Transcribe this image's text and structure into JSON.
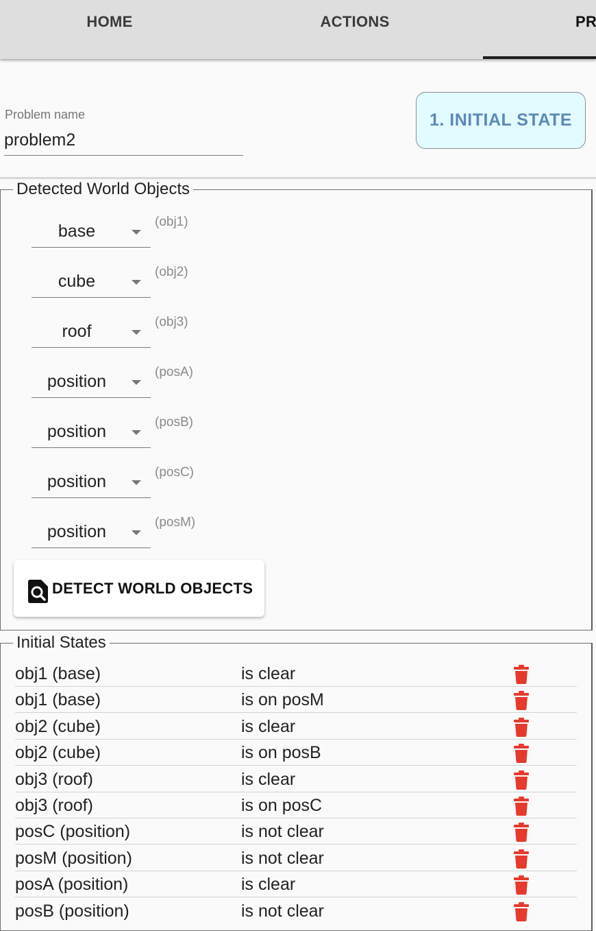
{
  "tabs": {
    "home": "HOME",
    "actions": "ACTIONS",
    "problems": "PROBLEMS",
    "active": "problems"
  },
  "header": {
    "problem_name_label": "Problem name",
    "problem_name_value": "problem2",
    "state_button": "1. INITIAL STATE"
  },
  "world_objects": {
    "legend": "Detected World Objects",
    "items": [
      {
        "type": "base",
        "id": "(obj1)"
      },
      {
        "type": "cube",
        "id": "(obj2)"
      },
      {
        "type": "roof",
        "id": "(obj3)"
      },
      {
        "type": "position",
        "id": "(posA)"
      },
      {
        "type": "position",
        "id": "(posB)"
      },
      {
        "type": "position",
        "id": "(posC)"
      },
      {
        "type": "position",
        "id": "(posM)"
      }
    ],
    "detect_button": "DETECT WORLD OBJECTS",
    "detect_icon": "search-file-icon"
  },
  "initial_states": {
    "legend": "Initial States",
    "rows": [
      {
        "object": "obj1 (base)",
        "predicate": "is clear"
      },
      {
        "object": "obj1 (base)",
        "predicate": "is on posM"
      },
      {
        "object": "obj2 (cube)",
        "predicate": "is clear"
      },
      {
        "object": "obj2 (cube)",
        "predicate": "is on posB"
      },
      {
        "object": "obj3 (roof)",
        "predicate": "is clear"
      },
      {
        "object": "obj3 (roof)",
        "predicate": "is on posC"
      },
      {
        "object": "posC (position)",
        "predicate": "is not clear"
      },
      {
        "object": "posM (position)",
        "predicate": "is not clear"
      },
      {
        "object": "posA (position)",
        "predicate": "is clear"
      },
      {
        "object": "posB (position)",
        "predicate": "is not clear"
      }
    ],
    "delete_icon": "trash-icon",
    "delete_color": "#e53a2c"
  },
  "colors": {
    "tabbar_bg": "#dedede",
    "state_button_bg": "#e2fbfe",
    "state_button_text": "#5b8ab8"
  }
}
